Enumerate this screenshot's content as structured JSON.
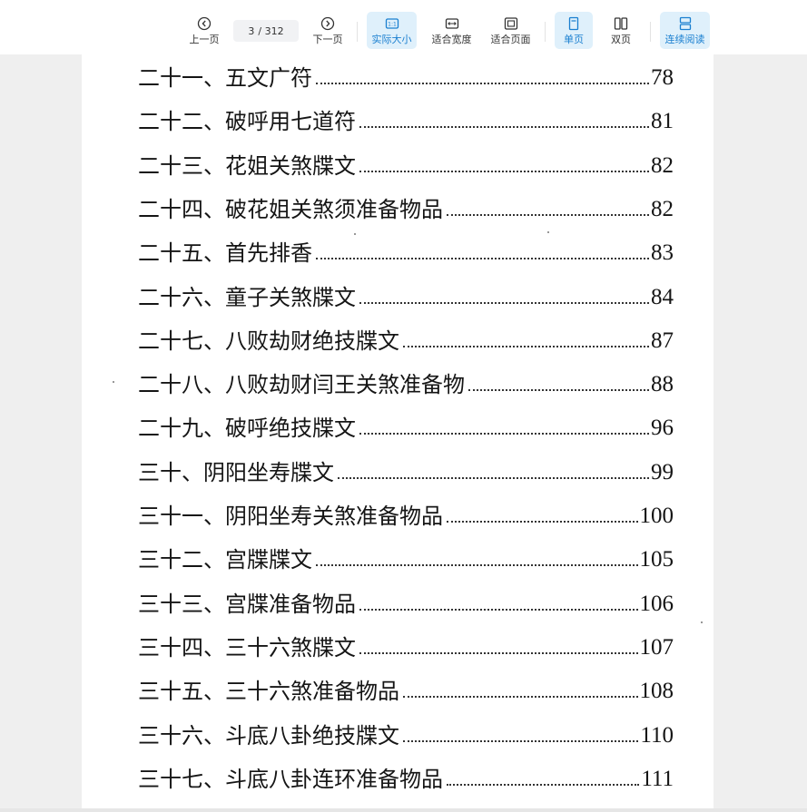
{
  "toolbar": {
    "prev_label": "上一页",
    "page_current": "3",
    "page_total": "/ 312",
    "next_label": "下一页",
    "actual_size_label": "实际大小",
    "fit_width_label": "适合宽度",
    "fit_page_label": "适合页面",
    "single_page_label": "单页",
    "double_page_label": "双页",
    "continuous_label": "连续阅读",
    "accent_color": "#1a7fd0"
  },
  "toc": [
    {
      "title": "二十一、五文广符",
      "page": "78"
    },
    {
      "title": "二十二、破呼用七道符",
      "page": "81"
    },
    {
      "title": "二十三、花姐关煞牒文",
      "page": "82"
    },
    {
      "title": "二十四、破花姐关煞须准备物品",
      "page": "82"
    },
    {
      "title": "二十五、首先排香",
      "page": "83"
    },
    {
      "title": "二十六、童子关煞牒文",
      "page": "84"
    },
    {
      "title": "二十七、八败劫财绝技牒文",
      "page": "87"
    },
    {
      "title": "二十八、八败劫财闫王关煞准备物",
      "page": "88"
    },
    {
      "title": "二十九、破呼绝技牒文",
      "page": "96"
    },
    {
      "title": "三十、阴阳坐寿牒文",
      "page": "99"
    },
    {
      "title": "三十一、阴阳坐寿关煞准备物品",
      "page": "100"
    },
    {
      "title": "三十二、宫牒牒文",
      "page": "105"
    },
    {
      "title": "三十三、宫牒准备物品",
      "page": "106"
    },
    {
      "title": "三十四、三十六煞牒文",
      "page": "107"
    },
    {
      "title": "三十五、三十六煞准备物品",
      "page": "108"
    },
    {
      "title": "三十六、斗底八卦绝技牒文",
      "page": "110"
    },
    {
      "title": "三十七、斗底八卦连环准备物品",
      "page": "111"
    }
  ]
}
